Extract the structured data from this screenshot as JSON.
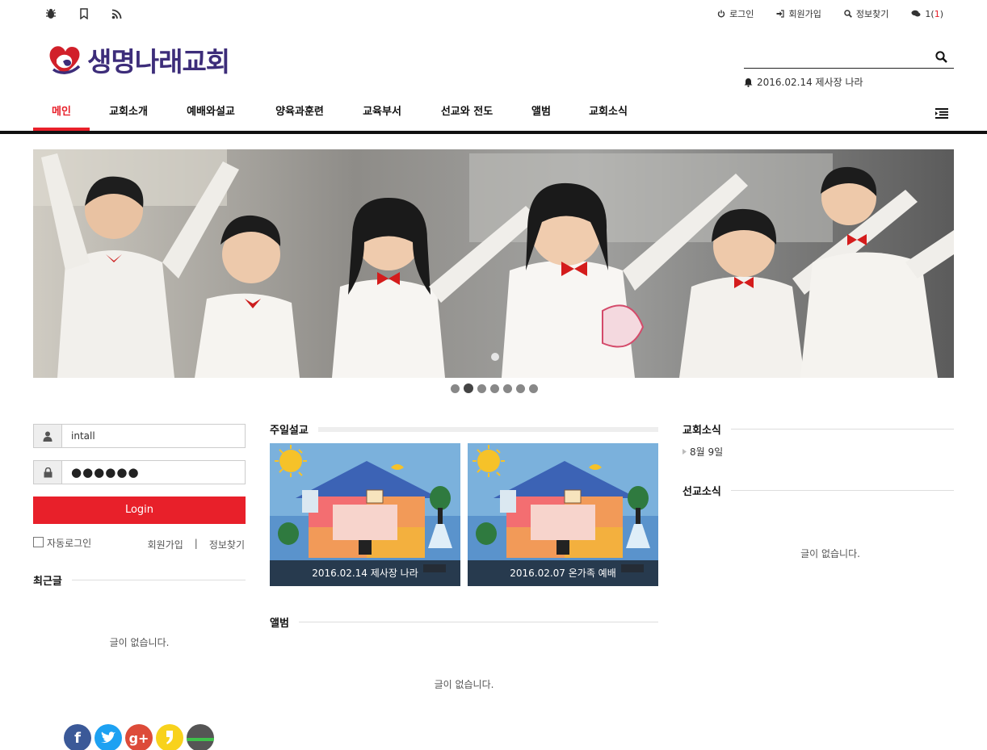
{
  "topbar": {
    "icons": [
      "bug-icon",
      "bookmark-icon",
      "rss-icon"
    ],
    "links": [
      {
        "label": "로그인",
        "icon": "power-icon"
      },
      {
        "label": "회원가입",
        "icon": "sign-in-icon"
      },
      {
        "label": "정보찾기",
        "icon": "search-icon"
      }
    ],
    "chat_count_prefix": "1(",
    "chat_count_new": "1",
    "chat_count_suffix": ")"
  },
  "logo": {
    "text": "생명나래교회",
    "color": "#3d2d7a",
    "accent": "#d1202a"
  },
  "header": {
    "search_placeholder": "",
    "notice": "2016.02.14 제사장 나라"
  },
  "nav": {
    "items": [
      "메인",
      "교회소개",
      "예배와설교",
      "양육과훈련",
      "교육부서",
      "선교와 전도",
      "앨범",
      "교회소식"
    ],
    "active_index": 0,
    "active_color": "#e8202a"
  },
  "slider": {
    "slide_count": 7,
    "active_slide": 2
  },
  "login": {
    "username_value": "intall",
    "password_mask": "●●●●●●",
    "button_label": "Login",
    "auto_login_label": "자동로그인",
    "join_label": "회원가입",
    "separator": "|",
    "find_label": "정보찾기"
  },
  "recent": {
    "title": "최근글",
    "empty": "글이 없습니다."
  },
  "sermons": {
    "title": "주일설교",
    "cards": [
      {
        "caption": "2016.02.14 제사장 나라"
      },
      {
        "caption": "2016.02.07 온가족 예배"
      }
    ]
  },
  "album": {
    "title": "앨범",
    "empty": "글이 없습니다."
  },
  "church_news": {
    "title": "교회소식",
    "items": [
      "8월 9일"
    ]
  },
  "mission_news": {
    "title": "선교소식",
    "empty": "글이 없습니다."
  },
  "social": [
    "facebook-icon",
    "twitter-icon",
    "google-plus-icon",
    "kakaostory-icon",
    "band-icon"
  ],
  "colors": {
    "accent": "#e8202a",
    "nav_border": "#111111"
  }
}
